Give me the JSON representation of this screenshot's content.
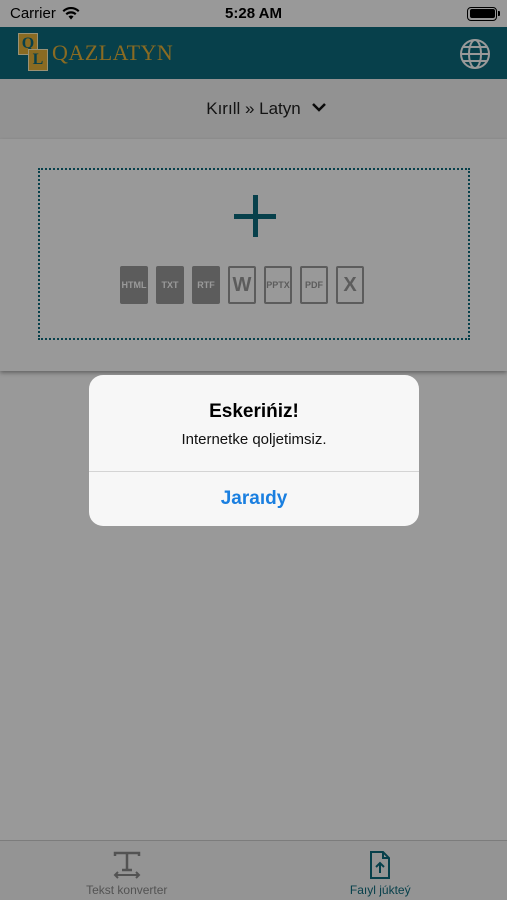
{
  "status": {
    "carrier": "Carrier",
    "time": "5:28 AM"
  },
  "header": {
    "logo_letters": [
      "Q",
      "L"
    ],
    "logo_text": "QAZLATYN",
    "accent": "#0c6b7d",
    "logo_color": "#e6b23a"
  },
  "converter": {
    "direction": "Kırıll » Latyn"
  },
  "dropzone": {
    "file_types": [
      "HTML",
      "TXT",
      "RTF",
      "W",
      "PPTX",
      "PDF",
      "X"
    ]
  },
  "alert": {
    "title": "Eskerińiz!",
    "message": "Internetke qoljetimsiz.",
    "button": "Jaraıdy"
  },
  "tabs": [
    {
      "label": "Tekst konverter",
      "icon": "text-icon",
      "active": false
    },
    {
      "label": "Faıyl júkteý",
      "icon": "file-upload-icon",
      "active": true
    }
  ]
}
